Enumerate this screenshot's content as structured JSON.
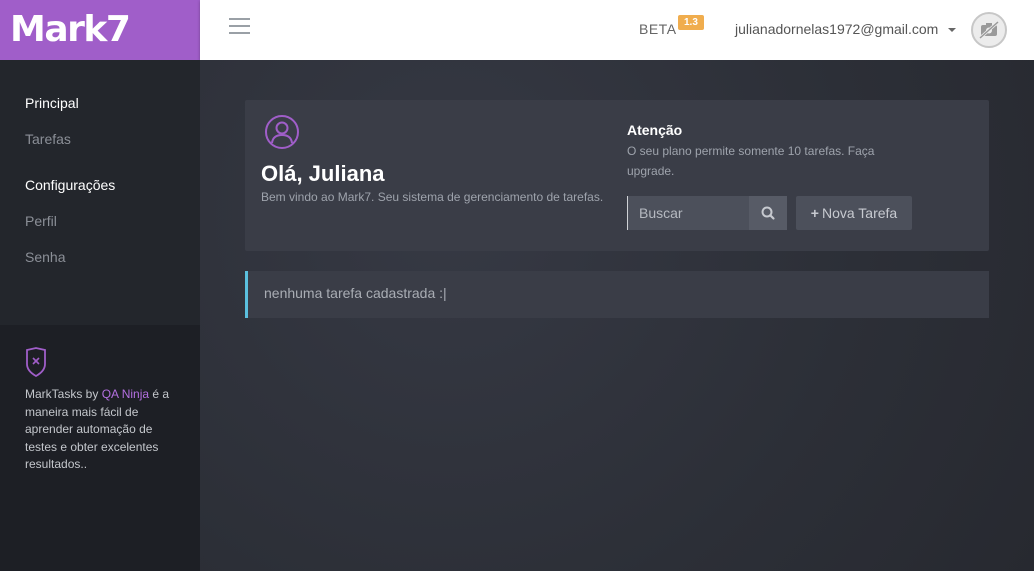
{
  "app": {
    "logo_text": "Mark7"
  },
  "header": {
    "beta_label": "BETA",
    "version_badge": "1.3",
    "user_email": "julianadornelas1972@gmail.com"
  },
  "sidebar": {
    "sections": [
      {
        "title": "Principal",
        "items": [
          "Tarefas"
        ]
      },
      {
        "title": "Configurações",
        "items": [
          "Perfil",
          "Senha"
        ]
      }
    ],
    "footer": {
      "text_before": "MarkTasks by ",
      "link_text": "QA Ninja",
      "text_after": " é a maneira mais fácil de aprender automação de testes e obter excelentes resultados.."
    }
  },
  "main": {
    "greeting": "Olá, Juliana",
    "welcome_text": "Bem vindo ao Mark7. Seu sistema de gerenciamento de tarefas.",
    "attention_title": "Atenção",
    "attention_text": "O seu plano permite somente 10 tarefas. Faça upgrade.",
    "search_placeholder": "Buscar",
    "new_task_label": "Nova Tarefa",
    "empty_message": "nenhuma tarefa cadastrada :|"
  },
  "colors": {
    "brand": "#a05ec9",
    "badge": "#f0ad4e",
    "info_border": "#5bc0de",
    "link": "#b36fe0"
  },
  "icons": [
    "menu-icon",
    "caret-down-icon",
    "no-camera-icon",
    "user-icon",
    "shield-x-icon",
    "search-icon",
    "plus-icon"
  ]
}
